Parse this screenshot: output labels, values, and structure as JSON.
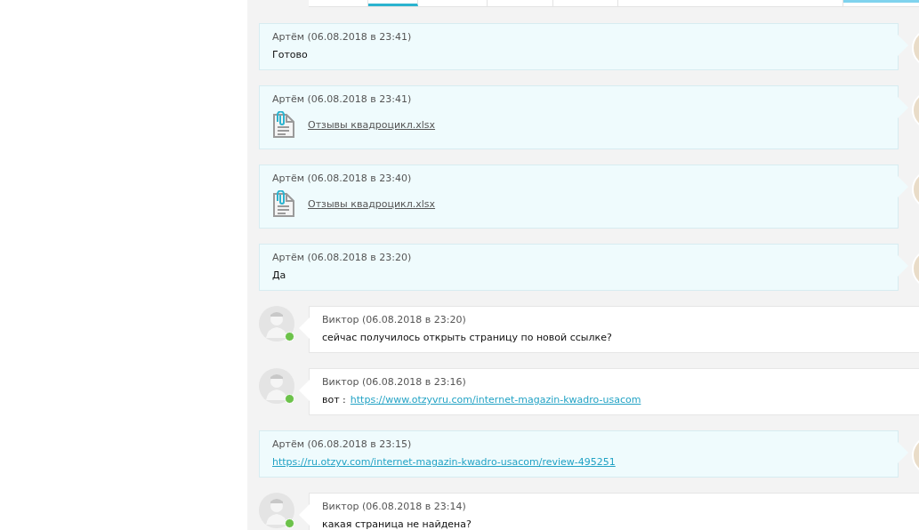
{
  "tabs": [
    {
      "selected": false
    },
    {
      "selected": true
    },
    {
      "selected": false
    },
    {
      "selected": false
    },
    {
      "selected": false
    },
    {
      "selected": false
    }
  ],
  "messages": [
    {
      "kind": "outgoing",
      "author": "Артём",
      "time": "(06.08.2018 в 23:41)",
      "text": "Готово"
    },
    {
      "kind": "outgoing",
      "author": "Артём",
      "time": "(06.08.2018 в 23:41)",
      "attachment": "Отзывы квадроцикл.xlsx"
    },
    {
      "kind": "outgoing",
      "author": "Артём",
      "time": "(06.08.2018 в 23:40)",
      "attachment": "Отзывы квадроцикл.xlsx"
    },
    {
      "kind": "outgoing",
      "author": "Артём",
      "time": "(06.08.2018 в 23:20)",
      "text": "Да"
    },
    {
      "kind": "incoming",
      "online": true,
      "author": "Виктор",
      "time": "(06.08.2018 в 23:20)",
      "text": "сейчас получилось открыть страницу по новой ссылке?"
    },
    {
      "kind": "incoming",
      "online": true,
      "author": "Виктор",
      "time": "(06.08.2018 в 23:16)",
      "text": "вот :",
      "link": "https://www.otzyvru.com/internet-magazin-kwadro-usacom"
    },
    {
      "kind": "outgoing",
      "author": "Артём",
      "time": "(06.08.2018 в 23:15)",
      "link": "https://ru.otzyv.com/internet-magazin-kwadro-usacom/review-495251"
    },
    {
      "kind": "incoming",
      "online": true,
      "author": "Виктор",
      "time": "(06.08.2018 в 23:14)",
      "text": "какая страница не найдена?"
    }
  ]
}
